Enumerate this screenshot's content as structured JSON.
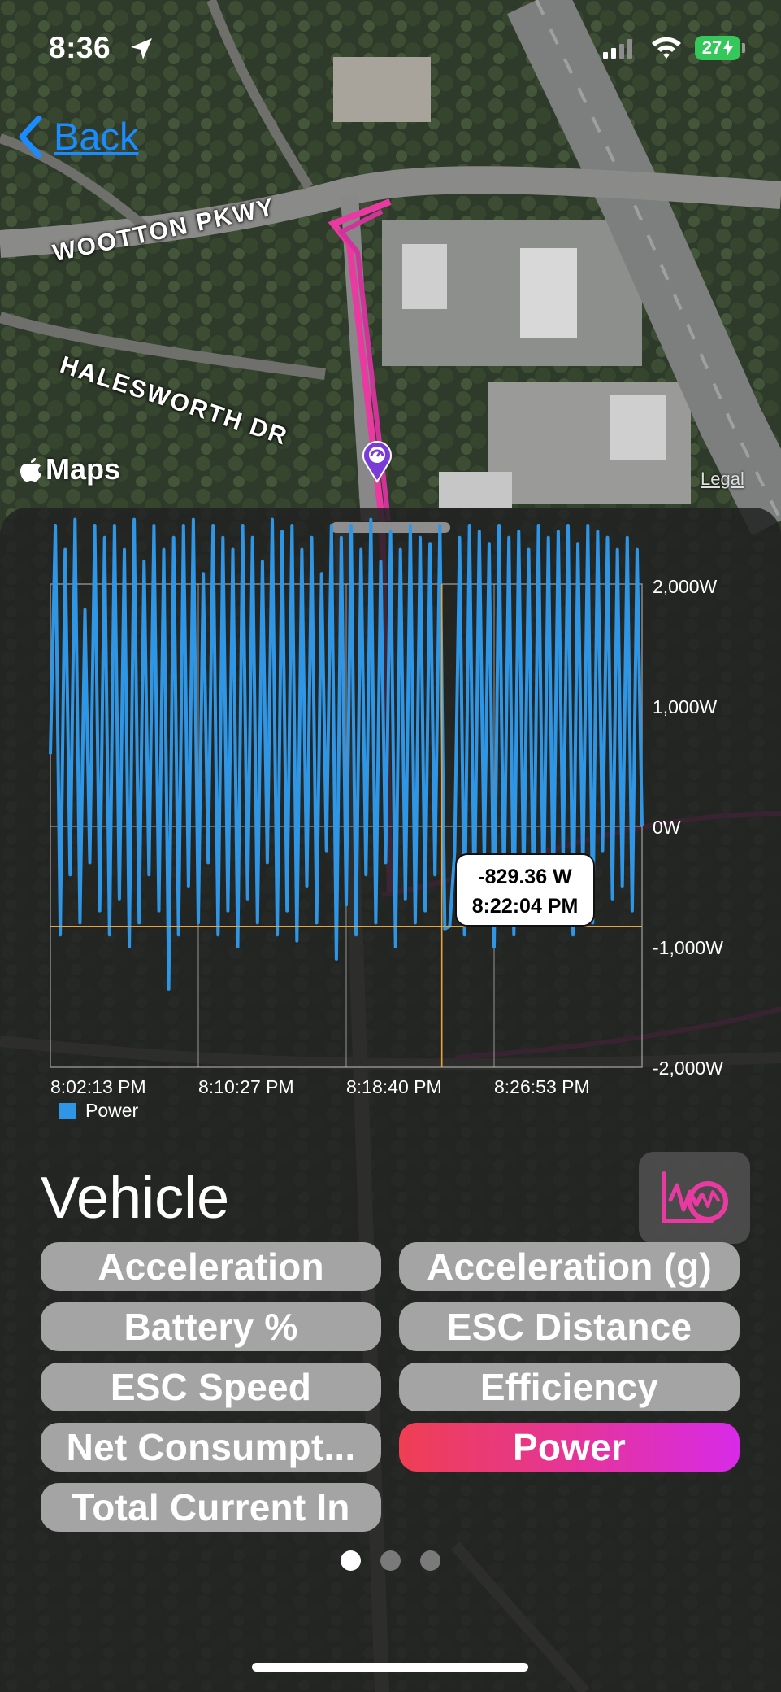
{
  "status_bar": {
    "time": "8:36",
    "battery": "27"
  },
  "nav": {
    "back_label": "Back"
  },
  "map": {
    "streets": [
      "WOOTTON PKWY",
      "HALESWORTH DR"
    ],
    "attribution": "Maps",
    "legal": "Legal"
  },
  "panel": {
    "title": "Vehicle",
    "metrics": [
      {
        "label": "Acceleration",
        "selected": false
      },
      {
        "label": "Acceleration (g)",
        "selected": false
      },
      {
        "label": "Battery %",
        "selected": false
      },
      {
        "label": "ESC Distance",
        "selected": false
      },
      {
        "label": "ESC Speed",
        "selected": false
      },
      {
        "label": "Efficiency",
        "selected": false
      },
      {
        "label": "Net Consumpt...",
        "selected": false
      },
      {
        "label": "Power",
        "selected": true
      },
      {
        "label": "Total Current In",
        "selected": false
      }
    ],
    "page_count": 3,
    "active_page": 0
  },
  "chart_data": {
    "type": "line",
    "series": [
      {
        "name": "Power",
        "color": "#2f96e6",
        "x_minutes": [
          0,
          0.25,
          0.5,
          0.75,
          1,
          1.25,
          1.5,
          1.75,
          2,
          2.25,
          2.5,
          2.75,
          3,
          3.25,
          3.5,
          3.75,
          4,
          4.25,
          4.5,
          4.75,
          5,
          5.25,
          5.5,
          5.75,
          6,
          6.25,
          6.5,
          6.75,
          7,
          7.25,
          7.5,
          7.75,
          8,
          8.25,
          8.5,
          8.75,
          9,
          9.25,
          9.5,
          9.75,
          10,
          10.25,
          10.5,
          10.75,
          11,
          11.25,
          11.5,
          11.75,
          12,
          12.25,
          12.5,
          12.75,
          13,
          13.25,
          13.5,
          13.75,
          14,
          14.25,
          14.5,
          14.75,
          15,
          15.25,
          15.5,
          15.75,
          16,
          16.25,
          16.5,
          16.75,
          17,
          17.25,
          17.5,
          17.75,
          18,
          18.25,
          18.5,
          18.75,
          19,
          19.25,
          19.5,
          19.75,
          20,
          20.25,
          20.5,
          20.75,
          21,
          21.25,
          21.5,
          21.75,
          22,
          22.25,
          22.5,
          22.75,
          23,
          23.25,
          23.5,
          23.75,
          24,
          24.25,
          24.5,
          24.75,
          25,
          25.25,
          25.5,
          25.75,
          26,
          26.25,
          26.5,
          26.75,
          27,
          27.25,
          27.5,
          27.75,
          28,
          28.25,
          28.5,
          28.75,
          29,
          29.25,
          29.5,
          29.75,
          30
        ],
        "values": [
          600,
          2500,
          -900,
          2300,
          -400,
          2550,
          -800,
          1800,
          -300,
          2500,
          -700,
          2400,
          -900,
          2500,
          -600,
          2300,
          -1000,
          2550,
          -800,
          2200,
          -400,
          2500,
          -700,
          2300,
          -1350,
          2400,
          -900,
          2500,
          -500,
          2550,
          -800,
          2100,
          -300,
          2500,
          -900,
          2400,
          -700,
          2300,
          -1000,
          2500,
          -600,
          2400,
          -800,
          2200,
          -300,
          2550,
          -900,
          2450,
          -700,
          2500,
          -950,
          2300,
          -500,
          2400,
          -800,
          2100,
          -200,
          2500,
          -1100,
          2400,
          -650,
          2500,
          -900,
          2300,
          -400,
          2550,
          -800,
          2200,
          -300,
          2450,
          -1000,
          2300,
          -600,
          2500,
          -800,
          2400,
          -700,
          2350,
          -400,
          2500,
          -850,
          -829,
          -200,
          2400,
          -900,
          2500,
          -700,
          2450,
          -300,
          2350,
          -1000,
          2500,
          -600,
          2400,
          -900,
          2450,
          -500,
          2300,
          -800,
          2500,
          -700,
          2400,
          -600,
          2450,
          -300,
          2500,
          -900,
          2350,
          -400,
          2500,
          -800,
          2450,
          -200,
          2400,
          -600,
          2300,
          -500,
          2400,
          -700,
          2300,
          0
        ],
        "y_unit": "W"
      }
    ],
    "x_tick_labels": [
      "8:02:13 PM",
      "8:10:27 PM",
      "8:18:40 PM",
      "8:26:53 PM"
    ],
    "y_tick_labels": [
      "2,000W",
      "1,000W",
      "0W",
      "-1,000W",
      "-2,000W"
    ],
    "y_ticks": [
      2000,
      1000,
      0,
      -1000,
      -2000
    ],
    "ylim": [
      -2000,
      2000
    ],
    "legend": "bottom-left",
    "grid": true,
    "selected_point": {
      "value_label": "-829.36 W",
      "time_label": "8:22:04 PM",
      "value": -829.36,
      "x_minutes": 19.85
    }
  }
}
